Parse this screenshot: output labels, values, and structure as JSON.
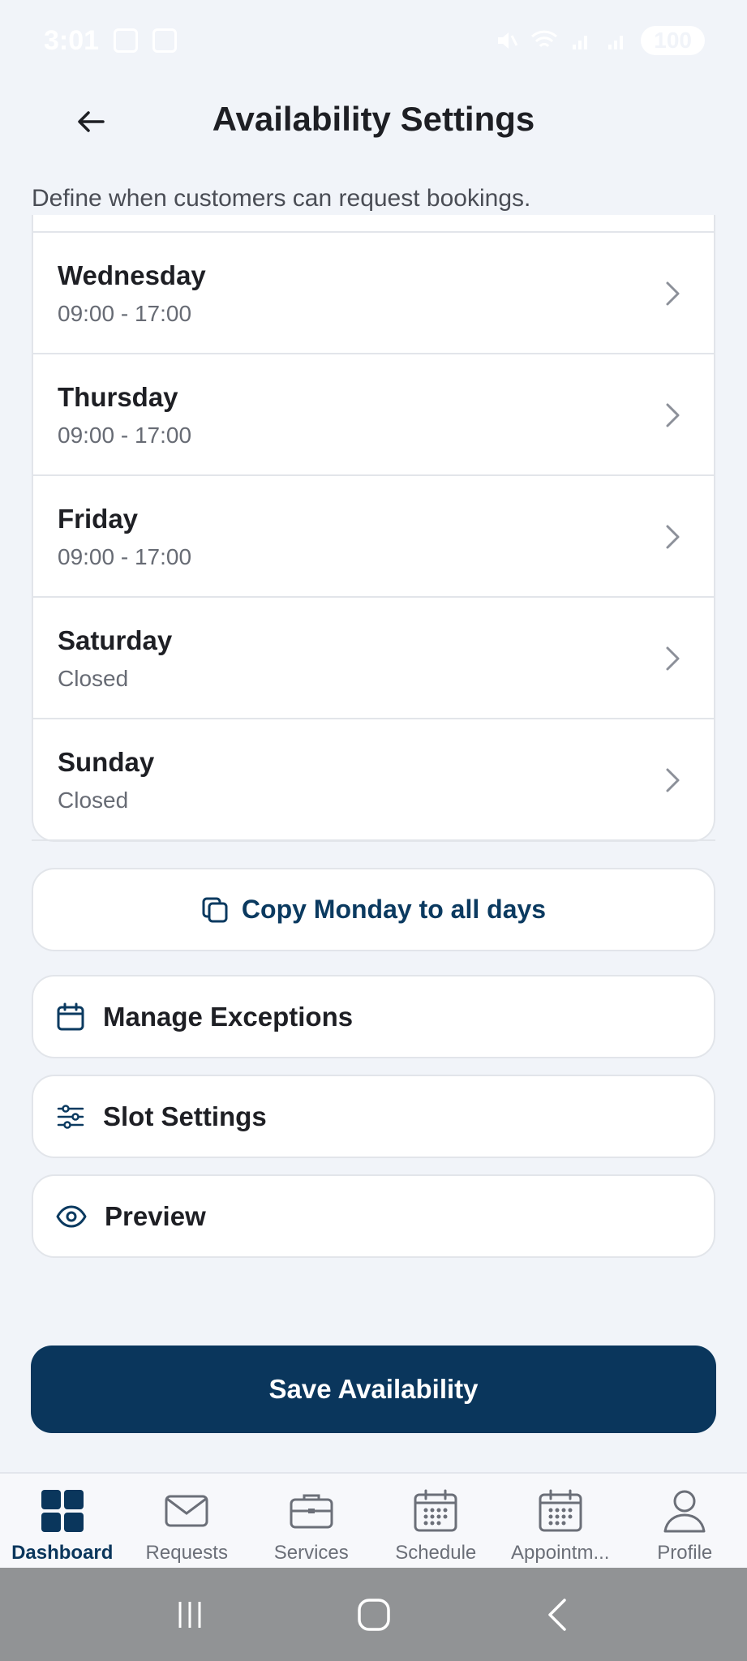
{
  "status_bar": {
    "time": "3:01",
    "battery": "100"
  },
  "header": {
    "title": "Availability Settings"
  },
  "subtitle": "Define when customers can request bookings.",
  "days": [
    {
      "name": "Wednesday",
      "hours": "09:00 - 17:00"
    },
    {
      "name": "Thursday",
      "hours": "09:00 - 17:00"
    },
    {
      "name": "Friday",
      "hours": "09:00 - 17:00"
    },
    {
      "name": "Saturday",
      "hours": "Closed"
    },
    {
      "name": "Sunday",
      "hours": "Closed"
    }
  ],
  "actions": {
    "copy_label": "Copy Monday to all days",
    "manage_exceptions": "Manage Exceptions",
    "slot_settings": "Slot Settings",
    "preview": "Preview",
    "save": "Save Availability"
  },
  "nav": {
    "items": [
      {
        "label": "Dashboard",
        "icon": "dashboard-icon"
      },
      {
        "label": "Requests",
        "icon": "mail-icon"
      },
      {
        "label": "Services",
        "icon": "briefcase-icon"
      },
      {
        "label": "Schedule",
        "icon": "calendar-icon"
      },
      {
        "label": "Appointm...",
        "icon": "calendar-icon"
      },
      {
        "label": "Profile",
        "icon": "person-icon"
      }
    ]
  },
  "colors": {
    "primary": "#0a365c",
    "background": "#f1f4f9",
    "accent_text": "#0b3a60"
  }
}
